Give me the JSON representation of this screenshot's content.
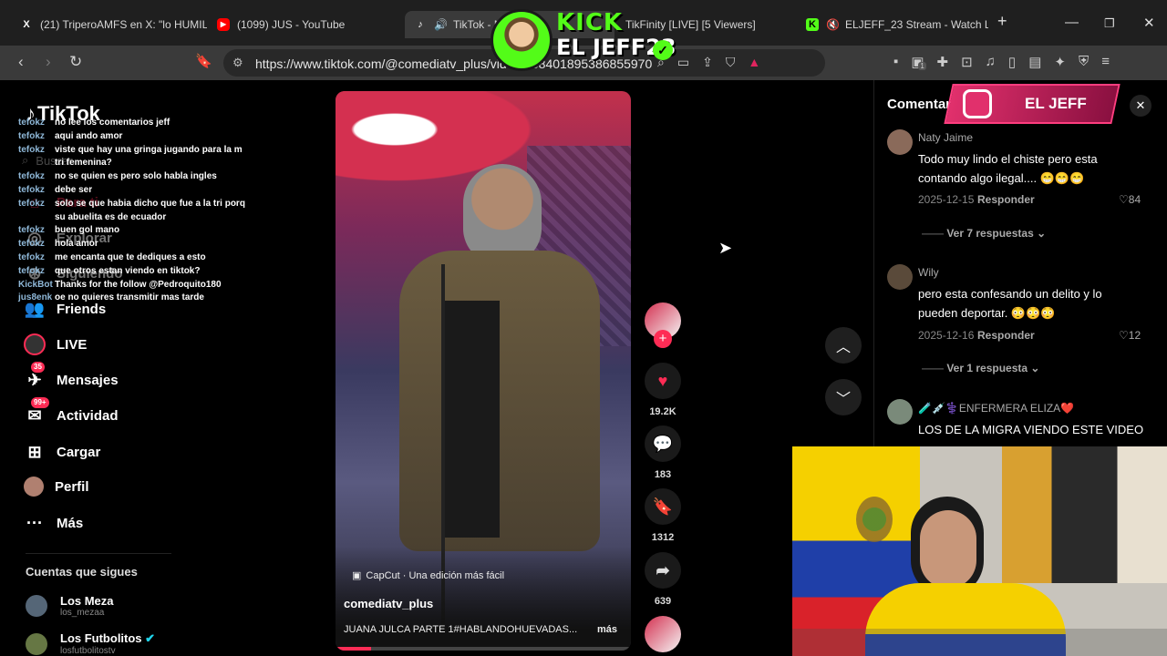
{
  "browser": {
    "tabs": [
      {
        "title": "(21) TriperoAMFS en X: \"lo HUMILL",
        "icon": "x-logo-icon"
      },
      {
        "title": "(1099) JUS - YouTube",
        "icon": "youtube-icon"
      },
      {
        "title": "TikTok - M",
        "icon": "tiktok-icon"
      },
      {
        "title": "TikFinity [LIVE] [5 Viewers]",
        "icon": "tikfinity-icon"
      },
      {
        "title": "ELJEFF_23 Stream - Watch Live",
        "icon": "kick-icon"
      }
    ],
    "url": "https://www.tiktok.com/@comediatv_plus/video/7584018953868559702",
    "ext_badge": "1"
  },
  "overlay": {
    "kick_label": "KICK",
    "streamer_name": "EL JEFF23",
    "instagram_name": "EL JEFF"
  },
  "sidebar": {
    "logo": "TikTok",
    "search_placeholder": "Buscar",
    "items": [
      {
        "label": "Para ti",
        "icon": "home-icon"
      },
      {
        "label": "Explorar",
        "icon": "compass-icon"
      },
      {
        "label": "Siguiendo",
        "icon": "following-icon"
      },
      {
        "label": "Friends",
        "icon": "friends-icon"
      },
      {
        "label": "LIVE",
        "icon": "live-icon"
      },
      {
        "label": "Mensajes",
        "icon": "message-icon",
        "badge": "35"
      },
      {
        "label": "Actividad",
        "icon": "activity-icon",
        "badge": "99+"
      },
      {
        "label": "Cargar",
        "icon": "upload-icon"
      },
      {
        "label": "Perfil",
        "icon": "profile-icon"
      },
      {
        "label": "Más",
        "icon": "more-icon"
      }
    ],
    "following_title": "Cuentas que sigues",
    "following": [
      {
        "name": "Los Meza",
        "handle": "los_mezaa"
      },
      {
        "name": "Los Futbolitos",
        "handle": "losfutbolitostv"
      }
    ]
  },
  "chat": [
    {
      "user": "tefokz",
      "msg": "no lee los comentarios jeff"
    },
    {
      "user": "tefokz",
      "msg": "aqui ando amor"
    },
    {
      "user": "tefokz",
      "msg": "viste que hay una gringa jugando para la m"
    },
    {
      "user": "",
      "msg": "tri femenina?"
    },
    {
      "user": "tefokz",
      "msg": "no se quien es pero solo habla ingles"
    },
    {
      "user": "tefokz",
      "msg": "debe ser"
    },
    {
      "user": "tefokz",
      "msg": "solo se que habia dicho que fue a la tri porq"
    },
    {
      "user": "",
      "msg": "su abuelita es de ecuador"
    },
    {
      "user": "tefokz",
      "msg": "buen gol mano"
    },
    {
      "user": "tefokz",
      "msg": "hola amor"
    },
    {
      "user": "tefokz",
      "msg": "me encanta que te dediques a esto"
    },
    {
      "user": "tefokz",
      "msg": "que otros estan viendo en tiktok?"
    },
    {
      "user": "KickBot",
      "msg": "Thanks for the follow @Pedroquito180"
    },
    {
      "user": "jus8enk",
      "msg": "oe no quieres transmitir mas tarde"
    }
  ],
  "video": {
    "author": "comediatv_plus",
    "caption": "JUANA JULCA PARTE 1#HABLANDOHUEVADAS...",
    "more": "más",
    "capcut": "CapCut · Una edición más fácil",
    "likes": "19.2K",
    "comments": "183",
    "saves": "1312",
    "shares": "639",
    "progress": 0.12
  },
  "comments": {
    "title": "Comentarios",
    "items": [
      {
        "user": "Naty Jaime",
        "text": "Todo muy lindo el chiste pero esta contando algo ilegal.... 😁😁😁",
        "date": "2025-12-15",
        "reply": "Responder",
        "likes": "84",
        "more": "Ver 7 respuestas"
      },
      {
        "user": "Wily",
        "text": "pero esta confesando un delito y lo pueden deportar. 😳😳😳",
        "date": "2025-12-16",
        "reply": "Responder",
        "likes": "12",
        "more": "Ver 1 respuesta"
      },
      {
        "user": "🧪💉⚕️ENFERMERA ELIZA❤️",
        "text": "LOS DE LA MIGRA VIENDO ESTE VIDEO"
      }
    ]
  },
  "colors": {
    "accent": "#fe2c55",
    "kick": "#53fc18",
    "bg": "#000000"
  }
}
